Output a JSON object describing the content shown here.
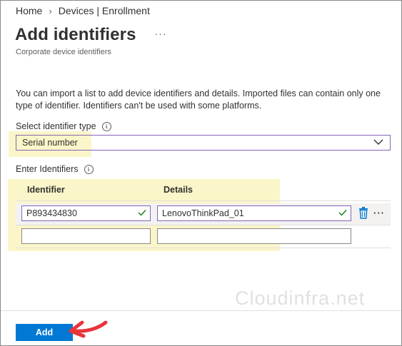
{
  "breadcrumb": {
    "home": "Home",
    "separator": "›",
    "current": "Devices | Enrollment"
  },
  "header": {
    "title": "Add identifiers",
    "more": "···",
    "subtitle": "Corporate device identifiers"
  },
  "description": "You can import a list to add device identifiers and details. Imported files can contain only one type of identifier. Identifiers can't be used with some platforms.",
  "identifier_type": {
    "label": "Select identifier type",
    "selected": "Serial number"
  },
  "identifiers": {
    "label": "Enter Identifiers",
    "columns": [
      "Identifier",
      "Details"
    ],
    "rows": [
      {
        "identifier": "P893434830",
        "details": "LenovoThinkPad_01"
      },
      {
        "identifier": "",
        "details": ""
      }
    ],
    "row_more": "···"
  },
  "watermark": "Cloudinfra.net",
  "footer": {
    "add_label": "Add"
  },
  "colors": {
    "accent": "#0078d4",
    "focus_border": "#8764b8",
    "valid_check": "#107c10",
    "highlight": "#fbf6c9",
    "annotation_arrow": "#e8353a"
  },
  "icons": [
    "chevron-right-icon",
    "info-icon",
    "chevron-down-icon",
    "checkmark-icon",
    "trash-icon",
    "more-icon",
    "arrow-icon"
  ]
}
